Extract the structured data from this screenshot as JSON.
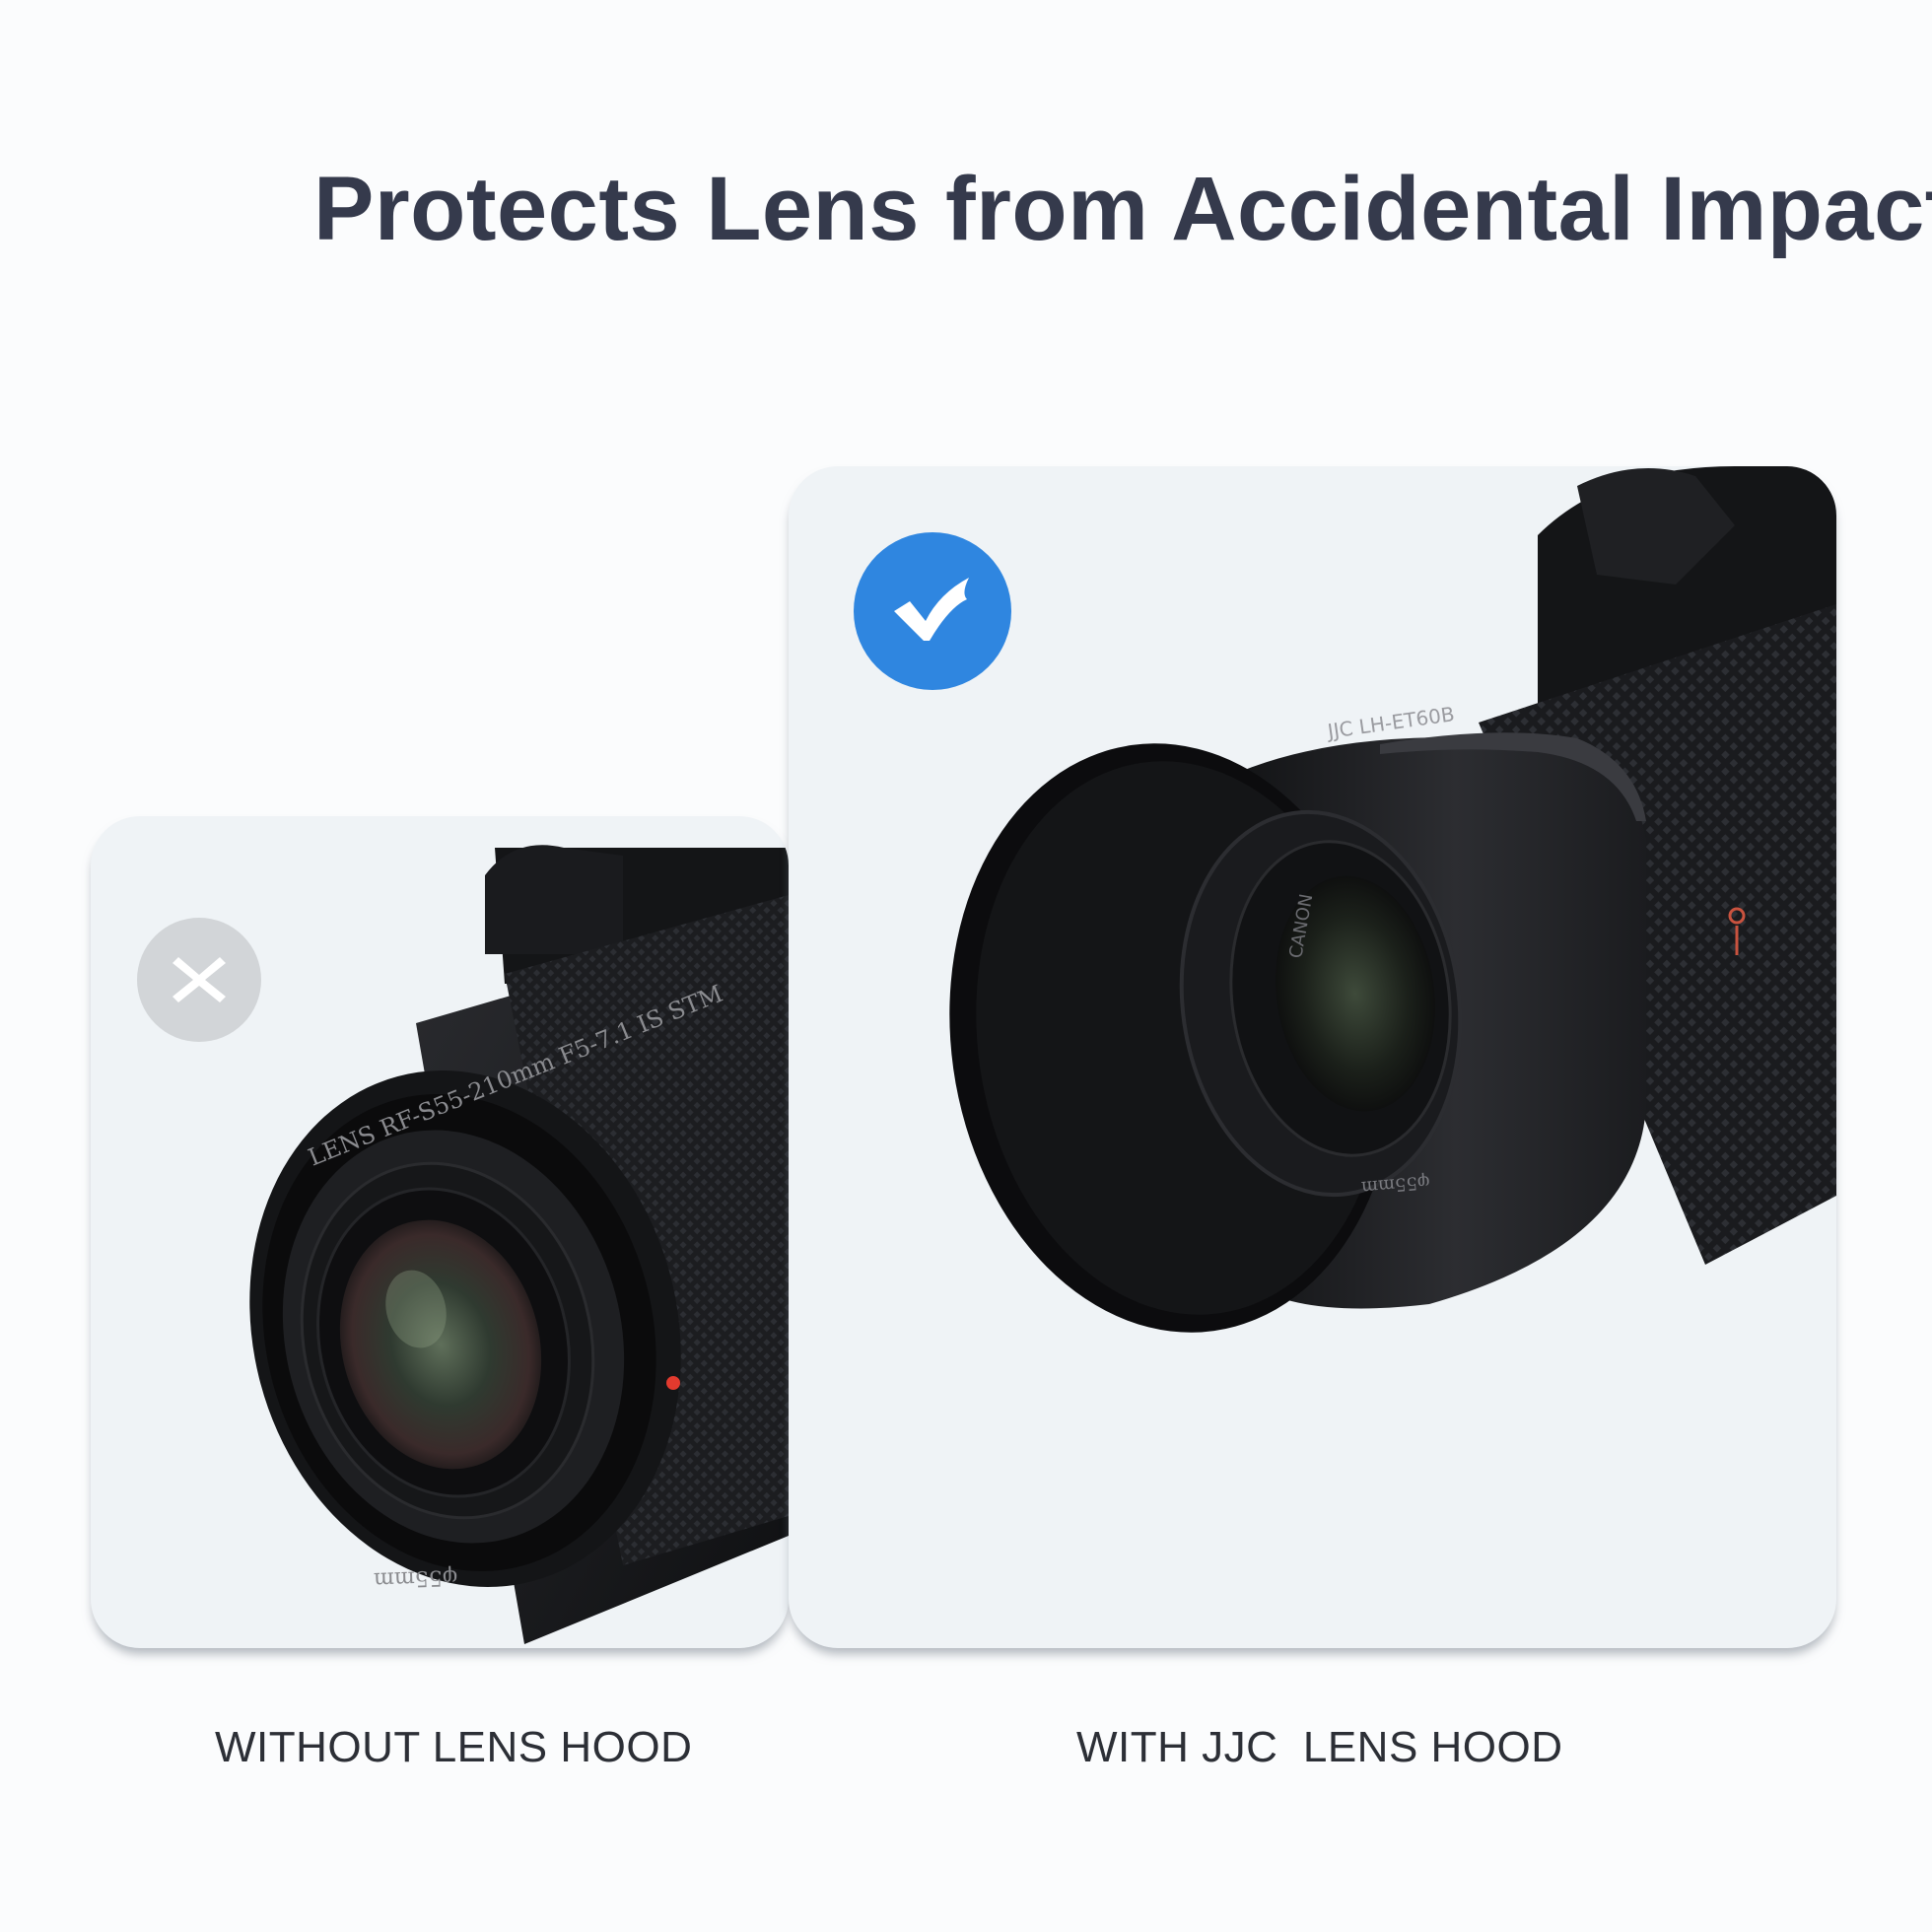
{
  "headline": "Protects Lens from Accidental Impact",
  "comparison": {
    "without": {
      "caption": "WITHOUT LENS HOOD",
      "status_icon": "x-icon",
      "badge_color": "#d2d5d8",
      "lens_ring_text": "LENS RF-S55-210mm F5-7.1 IS STM",
      "filter_text": "φ55mm"
    },
    "with": {
      "caption": "WITH JJC  LENS HOOD",
      "status_icon": "check-icon",
      "badge_color": "#2f86e0",
      "hood_text": "JJC LH-ET60B",
      "lens_text": "CANON",
      "filter_text": "φ55mm"
    }
  },
  "colors": {
    "title": "#353a4c",
    "card_background": "#eff3f6",
    "caption": "#2c2f36"
  }
}
